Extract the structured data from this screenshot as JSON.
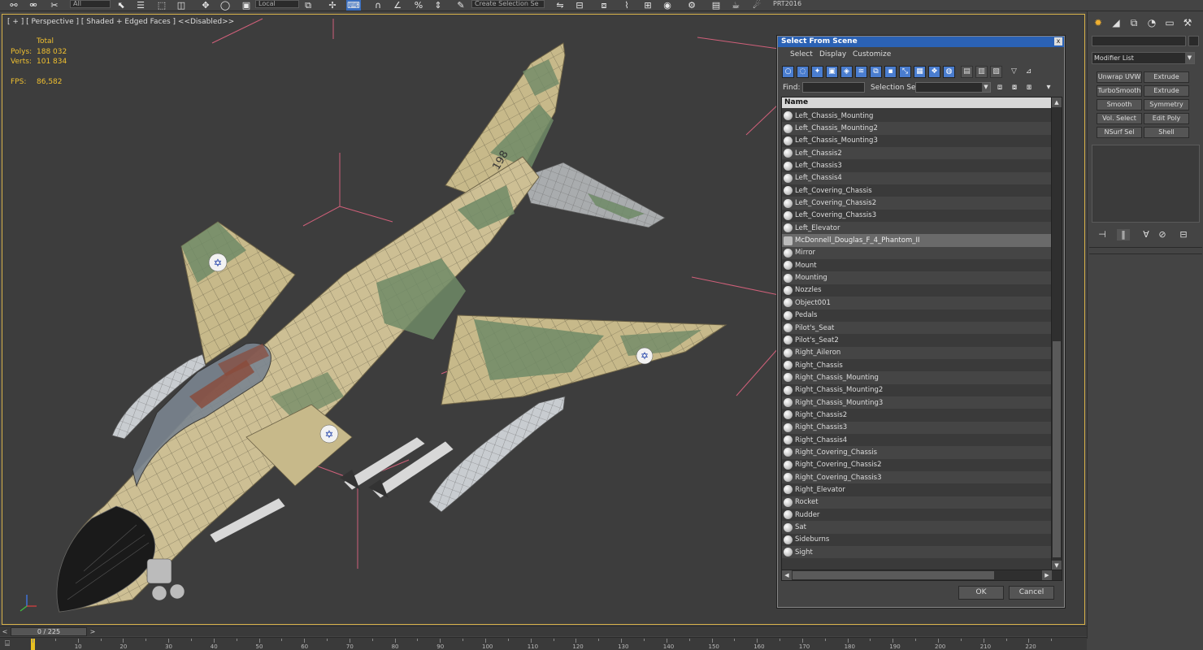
{
  "toolbar": {
    "ref_coord": "Local",
    "named_selection": "Create Selection Se",
    "renderer_label": "PRT2016",
    "small_field": "All"
  },
  "viewport": {
    "label": "[ + ] [ Perspective ] [ Shaded + Edged Faces ] <<Disabled>>",
    "stats": {
      "total_label": "Total",
      "polys_label": "Polys:",
      "polys_value": "188 032",
      "verts_label": "Verts:",
      "verts_value": "101 834",
      "fps_label": "FPS:",
      "fps_value": "86,582"
    },
    "colors": {
      "stats": "#f0c030",
      "border": "#d8b24a",
      "bg": "#3d3d3d"
    }
  },
  "command_panel": {
    "modifier_list": "Modifier List",
    "buttons": [
      "Unwrap UVW",
      "Extrude",
      "TurboSmooth",
      "Extrude",
      "Smooth",
      "Symmetry",
      "Vol. Select",
      "Edit Poly",
      "NSurf Sel",
      "Shell"
    ]
  },
  "dialog": {
    "title": "Select From Scene",
    "close": "x",
    "menu": [
      "Select",
      "Display",
      "Customize"
    ],
    "find_label": "Find:",
    "selection_set_label": "Selection Set:",
    "column_header": "Name",
    "ok": "OK",
    "cancel": "Cancel",
    "items": [
      {
        "name": "Left_Chassis_Mounting",
        "selected": false
      },
      {
        "name": "Left_Chassis_Mounting2",
        "selected": false
      },
      {
        "name": "Left_Chassis_Mounting3",
        "selected": false
      },
      {
        "name": "Left_Chassis2",
        "selected": false
      },
      {
        "name": "Left_Chassis3",
        "selected": false
      },
      {
        "name": "Left_Chassis4",
        "selected": false
      },
      {
        "name": "Left_Covering_Chassis",
        "selected": false
      },
      {
        "name": "Left_Covering_Chassis2",
        "selected": false
      },
      {
        "name": "Left_Covering_Chassis3",
        "selected": false
      },
      {
        "name": "Left_Elevator",
        "selected": false
      },
      {
        "name": "McDonnell_Douglas_F_4_Phantom_II",
        "selected": true
      },
      {
        "name": "Mirror",
        "selected": false
      },
      {
        "name": "Mount",
        "selected": false
      },
      {
        "name": "Mounting",
        "selected": false
      },
      {
        "name": "Nozzles",
        "selected": false
      },
      {
        "name": "Object001",
        "selected": false
      },
      {
        "name": "Pedals",
        "selected": false
      },
      {
        "name": "Pilot's_Seat",
        "selected": false
      },
      {
        "name": "Pilot's_Seat2",
        "selected": false
      },
      {
        "name": "Right_Aileron",
        "selected": false
      },
      {
        "name": "Right_Chassis",
        "selected": false
      },
      {
        "name": "Right_Chassis_Mounting",
        "selected": false
      },
      {
        "name": "Right_Chassis_Mounting2",
        "selected": false
      },
      {
        "name": "Right_Chassis_Mounting3",
        "selected": false
      },
      {
        "name": "Right_Chassis2",
        "selected": false
      },
      {
        "name": "Right_Chassis3",
        "selected": false
      },
      {
        "name": "Right_Chassis4",
        "selected": false
      },
      {
        "name": "Right_Covering_Chassis",
        "selected": false
      },
      {
        "name": "Right_Covering_Chassis2",
        "selected": false
      },
      {
        "name": "Right_Covering_Chassis3",
        "selected": false
      },
      {
        "name": "Right_Elevator",
        "selected": false
      },
      {
        "name": "Rocket",
        "selected": false
      },
      {
        "name": "Rudder",
        "selected": false
      },
      {
        "name": "Sat",
        "selected": false
      },
      {
        "name": "Sideburns",
        "selected": false
      },
      {
        "name": "Sight",
        "selected": false
      }
    ],
    "colors": {
      "title_bar": "#2b62b5",
      "tool_blue": "#4a7dcf",
      "selected_row": "#6a6a6a"
    }
  },
  "timeline": {
    "frame_display": "0 / 225",
    "prev": "<",
    "next": ">",
    "ticks": [
      "10",
      "20",
      "30",
      "40",
      "50",
      "60",
      "70",
      "80",
      "90",
      "100",
      "110",
      "120",
      "130",
      "140",
      "150",
      "160",
      "170",
      "180",
      "190",
      "200",
      "210",
      "220"
    ]
  }
}
